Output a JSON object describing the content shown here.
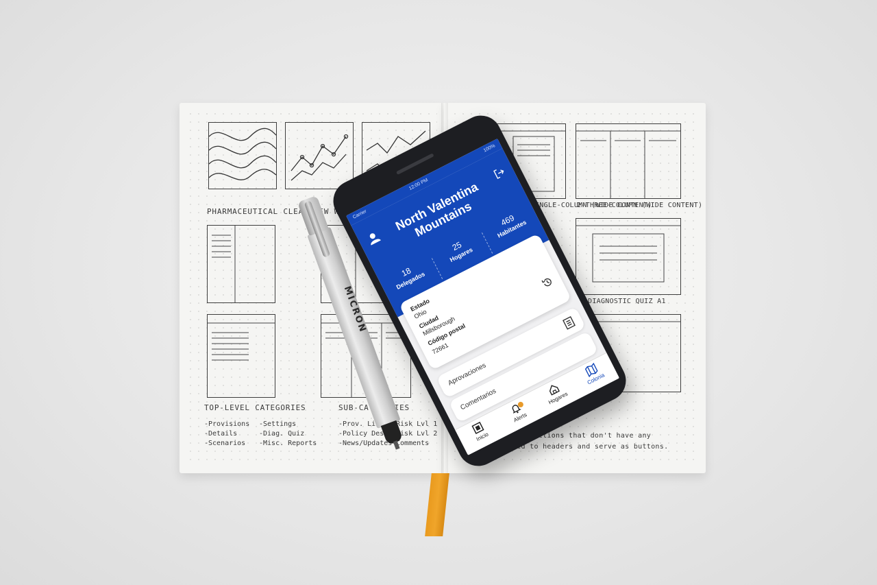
{
  "notebook": {
    "heading_wireframe": "PHARMACEUTICAL CLEARVIEW WIREFRAMES",
    "label_right_top": "1-SINGLE-COLUMN (WIDE CONTENT)",
    "label_right_top2": "2-THREE-COLUMN (WIDE CONTENT)",
    "label_diagnostic": "DIAGNOSTIC QUIZ A1",
    "top_level_heading": "TOP-LEVEL CATEGORIES",
    "sub_heading": "SUB-CATEGORIES",
    "top_level_items_1": [
      "-Provisions",
      "-Details",
      "-Scenarios"
    ],
    "top_level_items_2": [
      "-Settings",
      "-Diag. Quiz",
      "-Misc. Reports"
    ],
    "sub_items_1": [
      "-Prov. List",
      "-Policy Desc.",
      "-News/Updates"
    ],
    "sub_items_2": [
      "-Risk Lvl 1",
      "-Risk Lvl 2",
      "-Comments"
    ],
    "note_line_1": "to two columns. Sections that don't have any",
    "note_line_2": "content reduced to headers and serve as buttons."
  },
  "pen": {
    "brand": "MICRON"
  },
  "phone": {
    "status": {
      "left": "Carrier",
      "center": "12:00 PM",
      "right": "100%"
    },
    "title": "North Valentina Mountains",
    "stats": [
      {
        "value": "18",
        "label": "Delegados"
      },
      {
        "value": "25",
        "label": "Hogares"
      },
      {
        "value": "469",
        "label": "Habitantes"
      }
    ],
    "details": {
      "estado_label": "Estado",
      "estado_value": "Ohio",
      "ciudad_label": "Ciudad",
      "ciudad_value": "Millsborough",
      "cp_label": "Código postal",
      "cp_value": "72661"
    },
    "rows": {
      "aprovaciones": "Aprovaciones",
      "comentarios": "Comentarios"
    },
    "tabs": {
      "inicio": "Inicio",
      "alerts": "Alerts",
      "hogares": "Hogares",
      "colonia": "Colonia"
    },
    "accent": "#1448b9",
    "badge_color": "#e89a2a"
  }
}
